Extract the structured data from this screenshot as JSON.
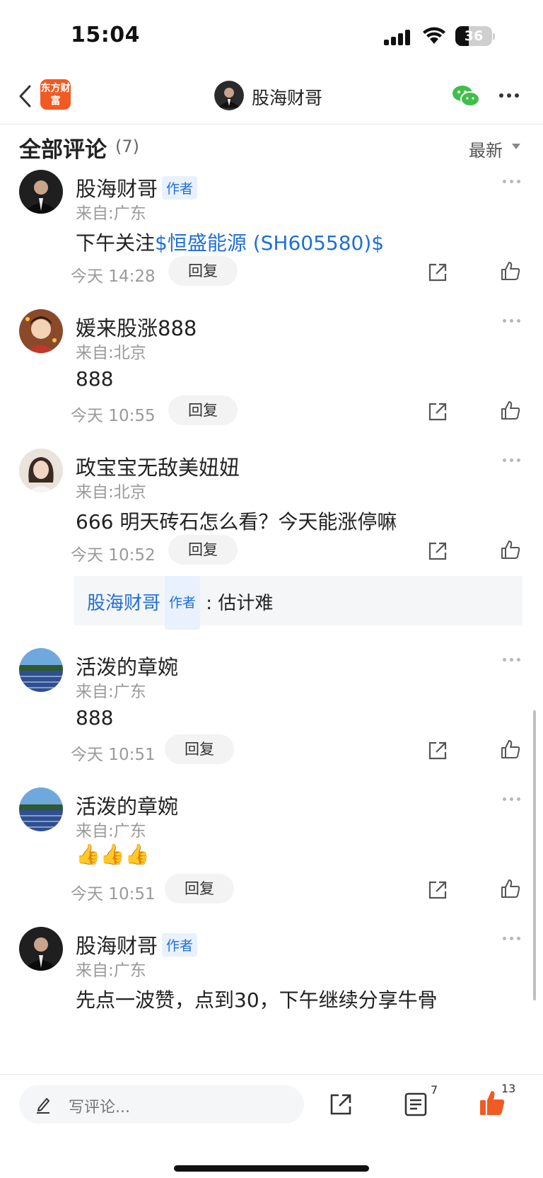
{
  "status_bar": {
    "time": "15:04",
    "battery": "36",
    "battery_level": 0.36
  },
  "nav": {
    "title": "股海财哥",
    "logo_text": "东方财富"
  },
  "header": {
    "title": "全部评论",
    "count": "(7)",
    "sort_label": "最新"
  },
  "comments": [
    {
      "name": "股海财哥",
      "author_tag": "作者",
      "location": "来自:广东",
      "content_text": "下午关注",
      "content_link": "$恒盛能源 (SH605580)$",
      "time": "今天 14:28",
      "reply_label": "回复"
    },
    {
      "name": "媛来股涨888",
      "location": "来自:北京",
      "content_text": "888",
      "time": "今天 10:55",
      "reply_label": "回复"
    },
    {
      "name": "政宝宝无敌美妞妞",
      "location": "来自:北京",
      "content_text": "666 明天砖石怎么看？今天能涨停嘛",
      "time": "今天 10:52",
      "reply_label": "回复",
      "sub_reply": {
        "name": "股海财哥",
        "author_tag": "作者",
        "separator": ":",
        "text": "估计难"
      }
    },
    {
      "name": "活泼的章婉",
      "location": "来自:广东",
      "content_text": "888",
      "time": "今天 10:51",
      "reply_label": "回复"
    },
    {
      "name": "活泼的章婉",
      "location": "来自:广东",
      "content_text": "👍👍👍",
      "time": "今天 10:51",
      "reply_label": "回复"
    },
    {
      "name": "股海财哥",
      "author_tag": "作者",
      "location": "来自:广东",
      "content_text": "先点一波赞，点到30，下午继续分享牛骨"
    }
  ],
  "bottom_bar": {
    "placeholder": "写评论...",
    "comment_count": "7",
    "like_count": "13"
  },
  "colors": {
    "accent": "#f15a22",
    "link": "#1f6fd6",
    "like": "#f15a22"
  }
}
